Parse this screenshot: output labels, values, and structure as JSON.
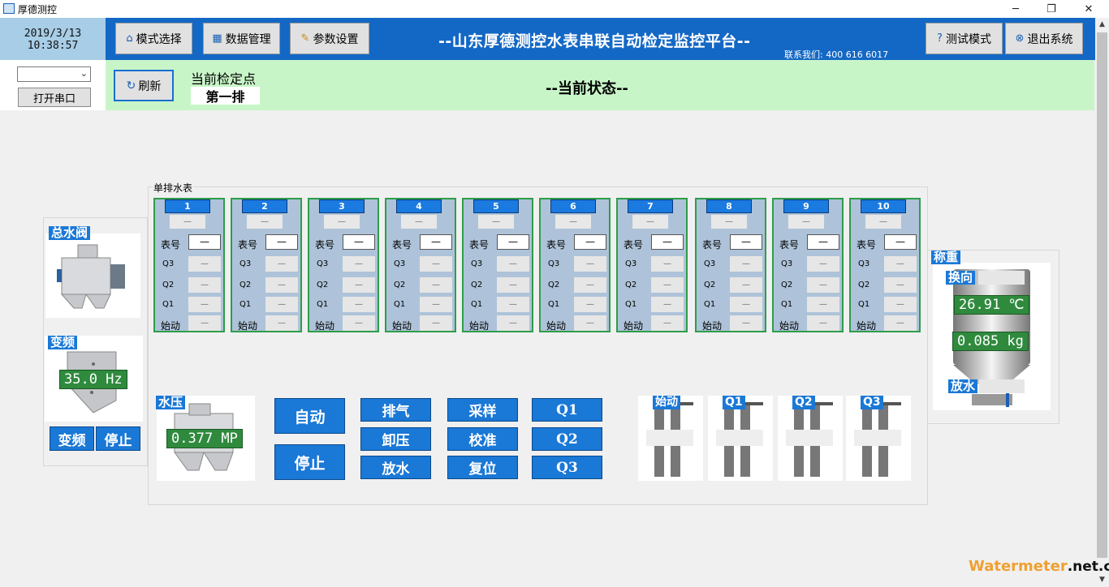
{
  "window": {
    "title": "厚德测控",
    "minimize": "─",
    "restore": "❐",
    "close": "✕"
  },
  "datetime": {
    "date": "2019/3/13",
    "time": "10:38:57"
  },
  "toolbar": {
    "mode_select": "模式选择",
    "data_manage": "数据管理",
    "param_settings": "参数设置",
    "test_mode": "测试模式",
    "exit": "退出系统"
  },
  "header": {
    "title": "--山东厚德测控水表串联自动检定监控平台--",
    "contact": "联系我们: 400 616 6017"
  },
  "serial": {
    "selected": "",
    "open_port": "打开串口"
  },
  "subbar": {
    "refresh": "刷新",
    "current_point_label": "当前检定点",
    "current_point_value": "第一排",
    "current_state": "--当前状态--"
  },
  "meter_group": {
    "title": "单排水表",
    "row_labels": {
      "meter_no": "表号",
      "q3": "Q3",
      "q2": "Q2",
      "q1": "Q1",
      "start": "始动"
    },
    "meters": [
      {
        "num": "1",
        "status": "—",
        "meter_no": "—",
        "q3": "—",
        "q2": "—",
        "q1": "—",
        "start": "—"
      },
      {
        "num": "2",
        "status": "—",
        "meter_no": "—",
        "q3": "—",
        "q2": "—",
        "q1": "—",
        "start": "—"
      },
      {
        "num": "3",
        "status": "—",
        "meter_no": "—",
        "q3": "—",
        "q2": "—",
        "q1": "—",
        "start": "—"
      },
      {
        "num": "4",
        "status": "—",
        "meter_no": "—",
        "q3": "—",
        "q2": "—",
        "q1": "—",
        "start": "—"
      },
      {
        "num": "5",
        "status": "—",
        "meter_no": "—",
        "q3": "—",
        "q2": "—",
        "q1": "—",
        "start": "—"
      },
      {
        "num": "6",
        "status": "—",
        "meter_no": "—",
        "q3": "—",
        "q2": "—",
        "q1": "—",
        "start": "—"
      },
      {
        "num": "7",
        "status": "—",
        "meter_no": "—",
        "q3": "—",
        "q2": "—",
        "q1": "—",
        "start": "—"
      },
      {
        "num": "8",
        "status": "—",
        "meter_no": "—",
        "q3": "—",
        "q2": "—",
        "q1": "—",
        "start": "—"
      },
      {
        "num": "9",
        "status": "—",
        "meter_no": "—",
        "q3": "—",
        "q2": "—",
        "q1": "—",
        "start": "—"
      },
      {
        "num": "10",
        "status": "—",
        "meter_no": "—",
        "q3": "—",
        "q2": "—",
        "q1": "—",
        "start": "—"
      }
    ]
  },
  "left_panel": {
    "main_valve": "总水阀",
    "vfd": "变频",
    "vfd_value": "35.0 Hz",
    "vfd_btn": "变频",
    "stop_btn": "停止"
  },
  "pressure": {
    "label": "水压",
    "value": "0.377 MP"
  },
  "controls": {
    "auto": "自动",
    "stop": "停止",
    "exhaust": "排气",
    "unload": "卸压",
    "drain": "放水",
    "sample": "采样",
    "calibrate": "校准",
    "reset": "复位",
    "q1": "Q1",
    "q2": "Q2",
    "q3": "Q3"
  },
  "valves": {
    "start": "始动",
    "q1": "Q1",
    "q2": "Q2",
    "q3": "Q3"
  },
  "weigh": {
    "title": "称重",
    "switch": "换向",
    "temperature": "26.91 ℃",
    "weight": "0.085 kg",
    "drain": "放水"
  },
  "watermark": {
    "brand": "Watermeter",
    "suffix": ".net.cn"
  },
  "colors": {
    "header_blue": "#1468c5",
    "status_green": "#c8f5c8",
    "ctrl_blue": "#1a78d6",
    "readout_green": "#2f8a3d"
  }
}
